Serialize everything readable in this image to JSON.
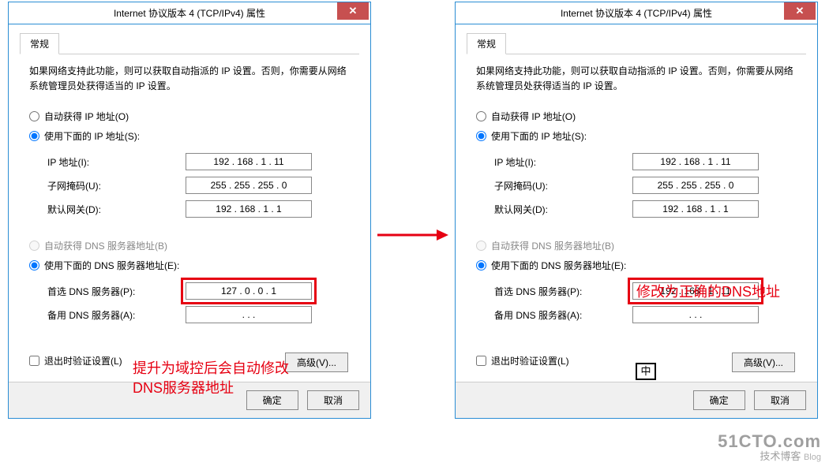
{
  "left": {
    "title": "Internet 协议版本 4 (TCP/IPv4) 属性",
    "tab": "常规",
    "desc": "如果网络支持此功能，则可以获取自动指派的 IP 设置。否则，你需要从网络系统管理员处获得适当的 IP 设置。",
    "autoIp": "自动获得 IP 地址(O)",
    "useIp": "使用下面的 IP 地址(S):",
    "ipLabel": "IP 地址(I):",
    "ipValue": "192 . 168 .   1   .  11",
    "maskLabel": "子网掩码(U):",
    "maskValue": "255 . 255 . 255 .   0",
    "gwLabel": "默认网关(D):",
    "gwValue": "192 . 168 .   1   .   1",
    "autoDns": "自动获得 DNS 服务器地址(B)",
    "useDns": "使用下面的 DNS 服务器地址(E):",
    "dns1Label": "首选 DNS 服务器(P):",
    "dns1Value": "127 .   0   .   0   .   1",
    "dns2Label": "备用 DNS 服务器(A):",
    "dns2Value": ".         .         .",
    "checkExit": "退出时验证设置(L)",
    "advanced": "高级(V)...",
    "ok": "确定",
    "cancel": "取消"
  },
  "right": {
    "title": "Internet 协议版本 4 (TCP/IPv4) 属性",
    "tab": "常规",
    "desc": "如果网络支持此功能，则可以获取自动指派的 IP 设置。否则，你需要从网络系统管理员处获得适当的 IP 设置。",
    "autoIp": "自动获得 IP 地址(O)",
    "useIp": "使用下面的 IP 地址(S):",
    "ipLabel": "IP 地址(I):",
    "ipValue": "192 . 168 .   1   .  11",
    "maskLabel": "子网掩码(U):",
    "maskValue": "255 . 255 . 255 .   0",
    "gwLabel": "默认网关(D):",
    "gwValue": "192 . 168 .   1   .   1",
    "autoDns": "自动获得 DNS 服务器地址(B)",
    "useDns": "使用下面的 DNS 服务器地址(E):",
    "dns1Label": "首选 DNS 服务器(P):",
    "dns1Value": "192 . 168 .   1   .  11",
    "dns2Label": "备用 DNS 服务器(A):",
    "dns2Value": ".         .         .",
    "checkExit": "退出时验证设置(L)",
    "advanced": "高级(V)...",
    "ok": "确定",
    "cancel": "取消"
  },
  "annotations": {
    "leftNote1": "提升为域控后会自动修改",
    "leftNote2": "DNS服务器地址",
    "rightNote": "修改为正确的DNS地址"
  },
  "ime": "中",
  "watermark": {
    "line1": "51CTO.com",
    "line2": "技术博客",
    "line3": "Blog"
  }
}
